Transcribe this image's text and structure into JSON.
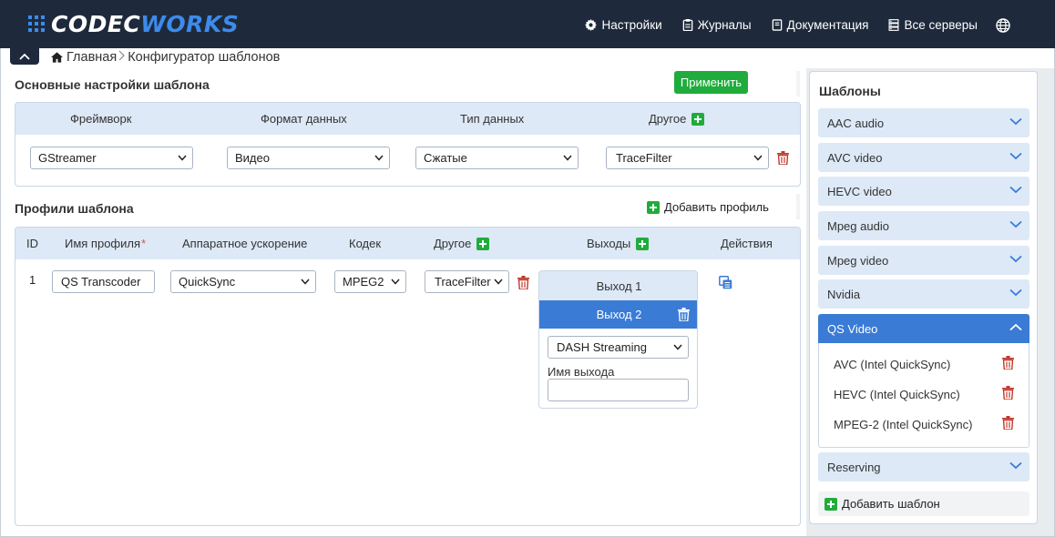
{
  "brand": {
    "part1": "CODEC",
    "part2": "WORKS"
  },
  "topnav": [
    {
      "icon": "gear-icon",
      "label": "Настройки"
    },
    {
      "icon": "journal-icon",
      "label": "Журналы"
    },
    {
      "icon": "book-icon",
      "label": "Документация"
    },
    {
      "icon": "server-icon",
      "label": "Все серверы"
    }
  ],
  "breadcrumb": {
    "home": "Главная",
    "current": "Конфигуратор шаблонов"
  },
  "basic": {
    "title": "Основные настройки шаблона",
    "apply_label": "Применить",
    "headers": {
      "framework": "Фреймворк",
      "format": "Формат данных",
      "type": "Тип данных",
      "other": "Другое"
    },
    "values": {
      "framework": "GStreamer",
      "format": "Видео",
      "type": "Сжатые",
      "other": "TraceFilter"
    }
  },
  "profiles": {
    "title": "Профили шаблона",
    "add_label": "Добавить профиль",
    "headers": {
      "id": "ID",
      "name": "Имя профиля",
      "required_mark": "*",
      "hw": "Аппаратное ускорение",
      "codec": "Кодек",
      "other": "Другое",
      "outputs": "Выходы",
      "actions": "Действия"
    },
    "rows": [
      {
        "id": "1",
        "name": "QS Transcoder",
        "hw": "QuickSync",
        "codec": "MPEG2",
        "other": "TraceFilter",
        "outputs": {
          "tabs": [
            "Выход 1",
            "Выход 2"
          ],
          "active_tab": "Выход 2",
          "protocol": "DASH Streaming",
          "name_label": "Имя выхода",
          "name_value": ""
        }
      }
    ]
  },
  "sidebar": {
    "title": "Шаблоны",
    "groups": [
      {
        "label": "AAC audio",
        "expanded": false
      },
      {
        "label": "AVC video",
        "expanded": false
      },
      {
        "label": "HEVC video",
        "expanded": false
      },
      {
        "label": "Mpeg audio",
        "expanded": false
      },
      {
        "label": "Mpeg video",
        "expanded": false
      },
      {
        "label": "Nvidia",
        "expanded": false
      },
      {
        "label": "QS Video",
        "expanded": true
      },
      {
        "label": "Reserving",
        "expanded": false
      }
    ],
    "expanded_items": [
      "AVC (Intel QuickSync)",
      "HEVC (Intel QuickSync)",
      "MPEG-2 (Intel QuickSync)"
    ],
    "add_label": "Добавить шаблон"
  },
  "colors": {
    "header_bg": "#1e2a3c",
    "brand_blue": "#3d8bea",
    "accent_blue": "#3a7bd5",
    "light_blue": "#dde9f7",
    "green": "#1fac3c",
    "delete_red": "#c0392b"
  }
}
